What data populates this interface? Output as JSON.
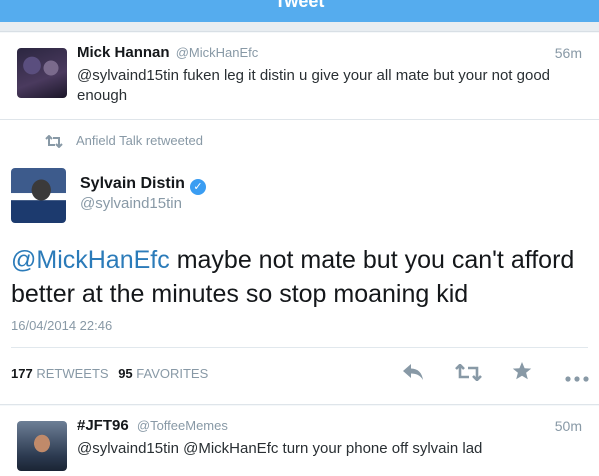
{
  "header": {
    "title": "Tweet"
  },
  "colors": {
    "accent": "#55acee",
    "link": "#2b7bb9",
    "muted": "#8899a6",
    "verified": "#3a9df2"
  },
  "tweet_above": {
    "name": "Mick Hannan",
    "handle": "@MickHanEfc",
    "time": "56m",
    "text": "@sylvaind15tin fuken leg it distin u give your all mate but your not good enough"
  },
  "main_tweet": {
    "retweet_notice": "Anfield Talk retweeted",
    "name": "Sylvain Distin",
    "handle": "@sylvaind15tin",
    "mention": "@MickHanEfc",
    "text": " maybe not mate but you can't afford better at the minutes so stop moaning kid",
    "date": "16/04/2014 22:46",
    "retweets_count": "177",
    "retweets_label": "RETWEETS",
    "favorites_count": "95",
    "favorites_label": "FAVORITES",
    "icons": [
      "reply-icon",
      "retweet-icon",
      "favorite-icon",
      "more-icon"
    ]
  },
  "tweet_below": {
    "name": "#JFT96",
    "handle": "@ToffeeMemes",
    "time": "50m",
    "text": "@sylvaind15tin @MickHanEfc turn your phone off sylvain lad"
  }
}
